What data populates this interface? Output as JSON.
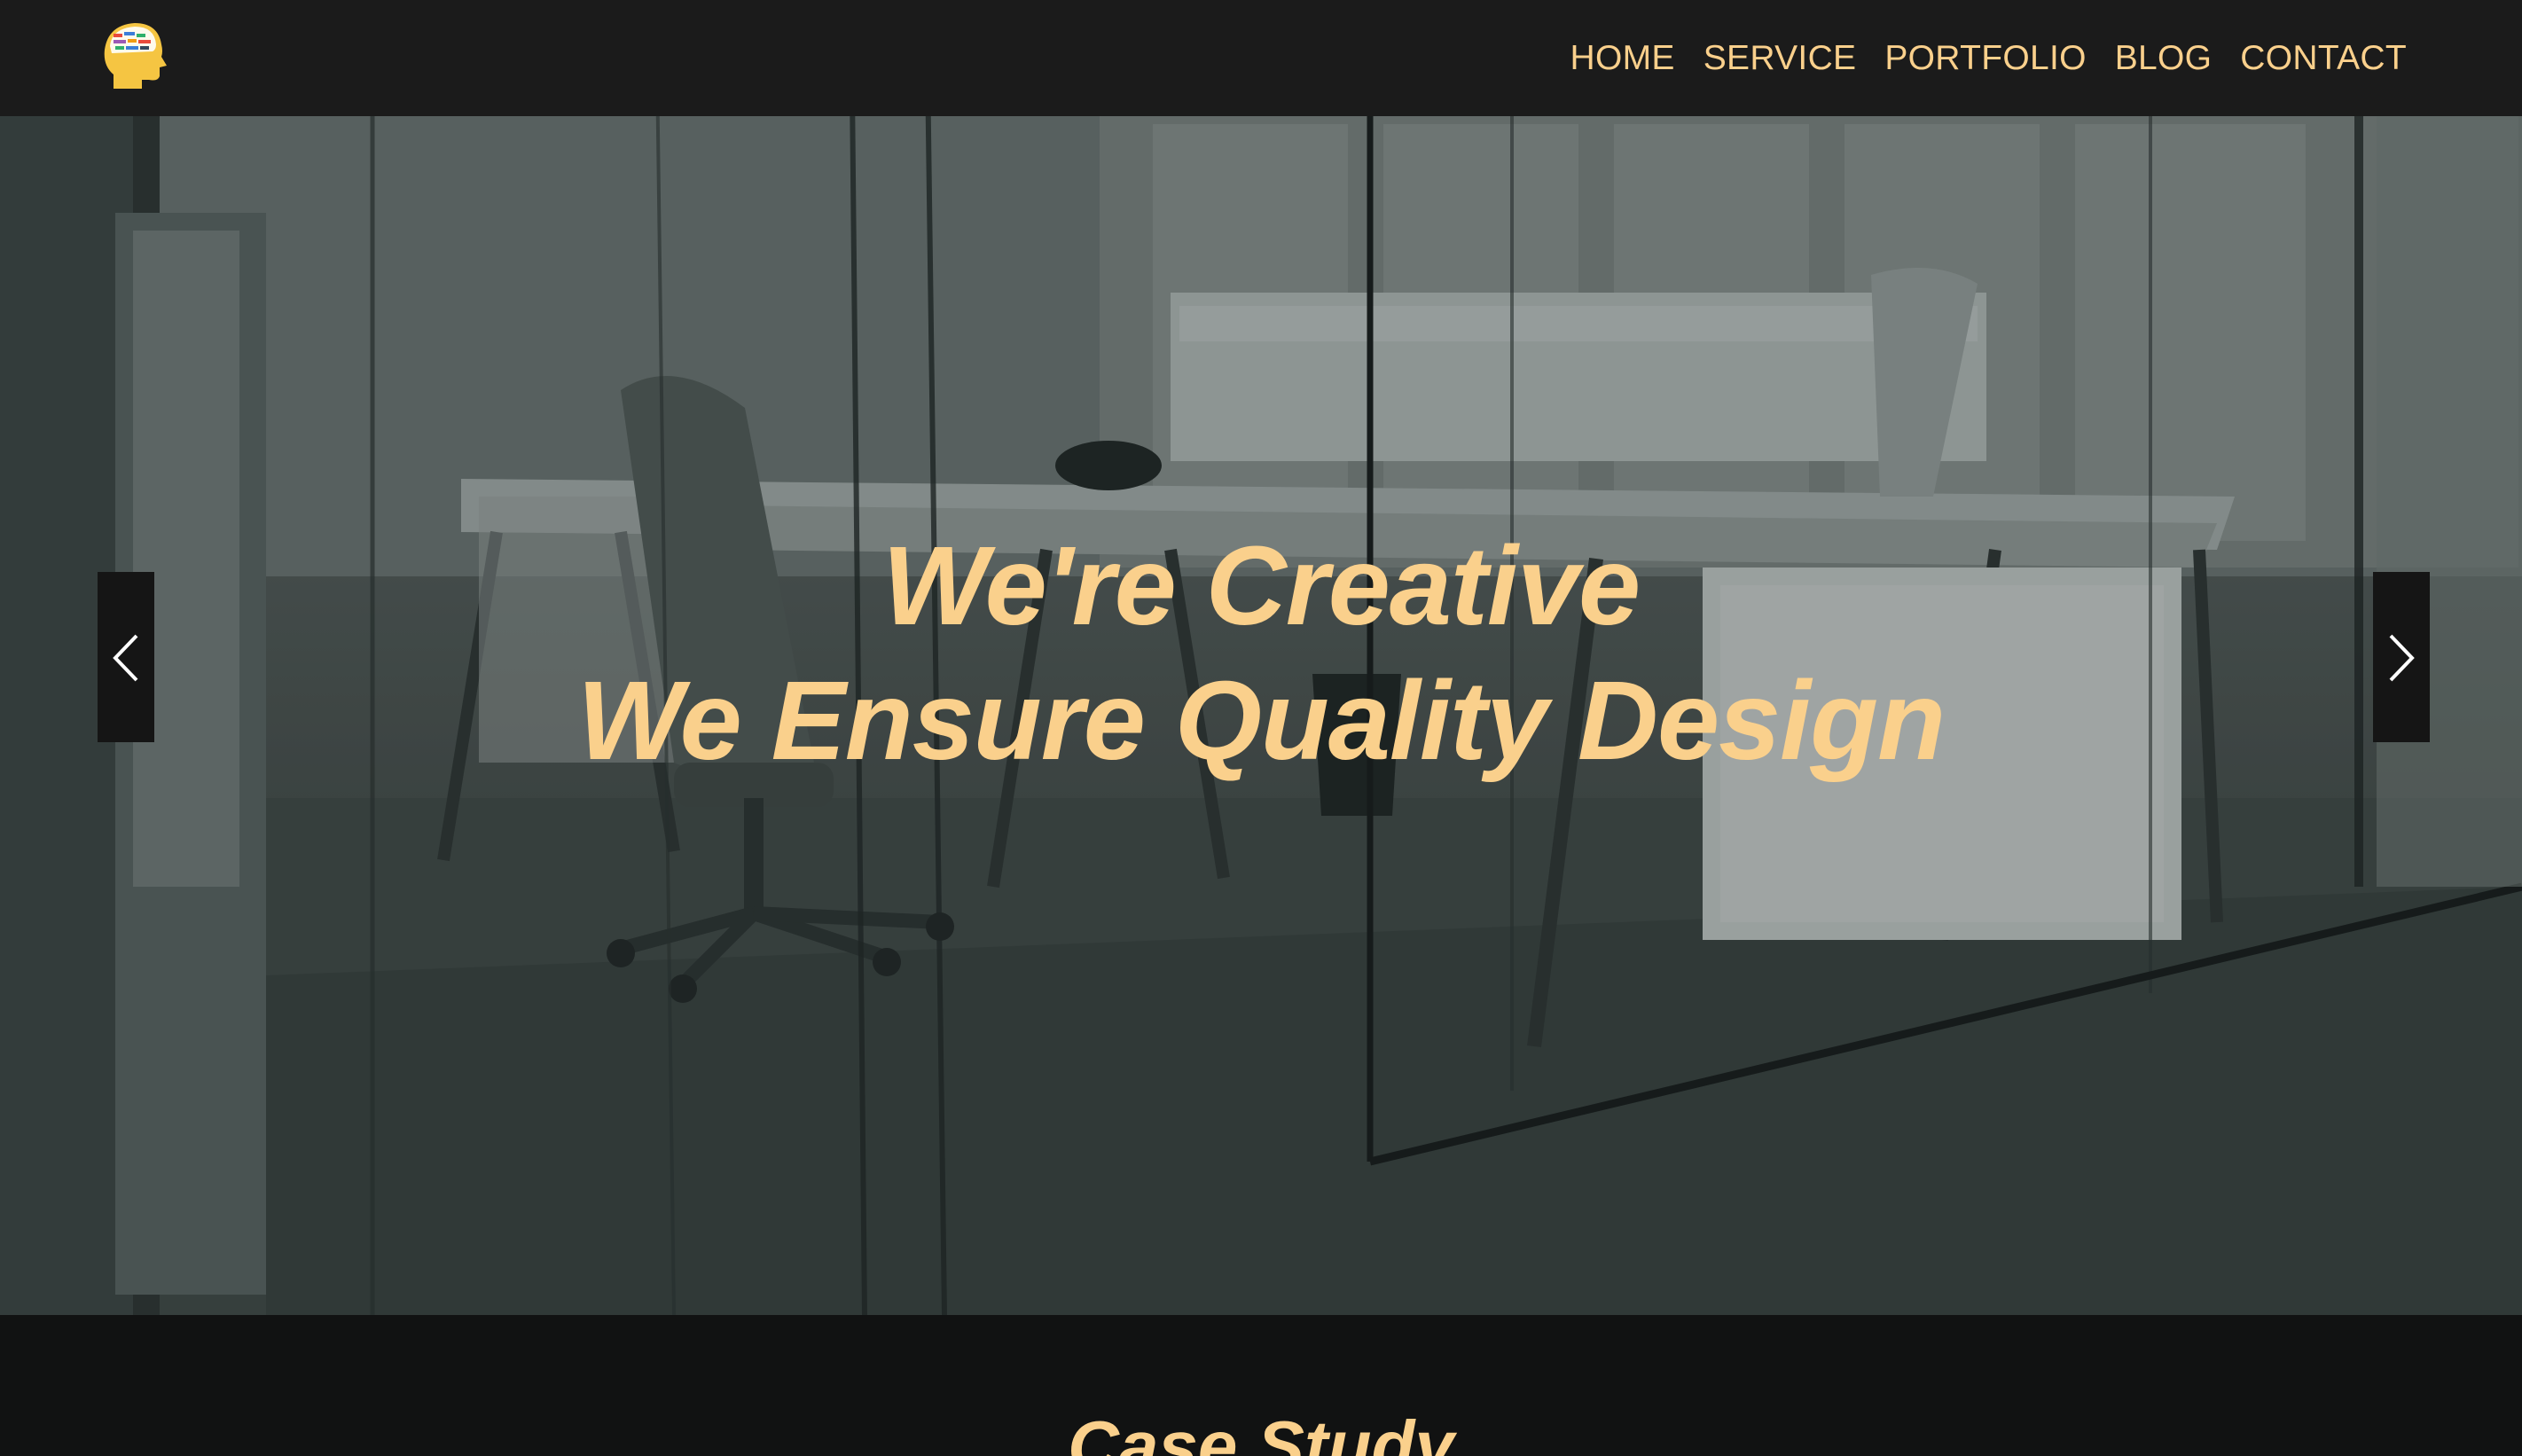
{
  "nav": {
    "logo_name": "brain-head-logo",
    "items": [
      {
        "label": "HOME"
      },
      {
        "label": "SERVICE"
      },
      {
        "label": "PORTFOLIO"
      },
      {
        "label": "BLOG"
      },
      {
        "label": "CONTACT"
      }
    ]
  },
  "hero": {
    "title_line1": "We're Creative",
    "title_line2": "We Ensure Quality Design",
    "prev_icon": "chevron-left-icon",
    "next_icon": "chevron-right-icon"
  },
  "case_study": {
    "title": "Case Study"
  },
  "colors": {
    "accent": "#fad08c",
    "navbar_bg": "#1b1b1b",
    "page_bg": "#111212",
    "arrow_bg": "#151515"
  }
}
